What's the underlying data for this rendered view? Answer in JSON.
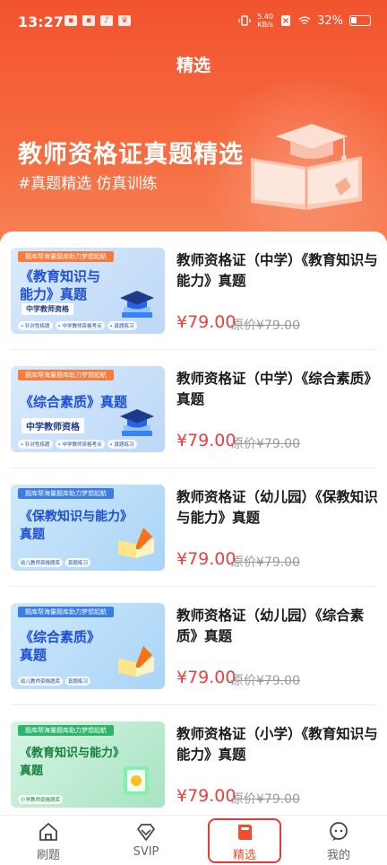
{
  "status_bar": {
    "time": "13:27",
    "net_speed_value": "5.40",
    "net_speed_unit": "KB/s",
    "battery": "32%"
  },
  "page": {
    "title": "精选"
  },
  "banner": {
    "title": "教师资格证真题精选",
    "subtitle": "#真题精选 仿真训练"
  },
  "items": [
    {
      "title": "教师资格证（中学）《教育知识与能力》真题",
      "price": "¥79.00",
      "original_price": "原价¥79.00",
      "thumb": {
        "tag": "题库帮海量题库助力梦想起航",
        "line1": "《教育知识与",
        "line2": "能力》真题",
        "sub": "中学教师资格",
        "chips": [
          "• 针对性练题",
          "• 中学教师资格考点",
          "• 真题练习"
        ]
      }
    },
    {
      "title": "教师资格证（中学）《综合素质》真题",
      "price": "¥79.00",
      "original_price": "原价¥79.00",
      "thumb": {
        "tag": "题库帮海量题库助力梦想起航",
        "line1": "《综合素质》真题",
        "line2": "",
        "sub": "中学教师资格",
        "chips": [
          "• 针对性练题",
          "• 中学教师资格考点",
          "• 真题练习"
        ]
      }
    },
    {
      "title": "教师资格证（幼儿园）《保教知识与能力》真题",
      "price": "¥79.00",
      "original_price": "原价¥79.00",
      "thumb": {
        "tag": "题库帮海量题库助力梦想起航",
        "line1": "《保教知识与能力》",
        "line2": "真题",
        "sub": "",
        "chips": [
          "幼儿教师资格题库",
          "真题练习"
        ]
      }
    },
    {
      "title": "教师资格证（幼儿园）《综合素质》真题",
      "price": "¥79.00",
      "original_price": "原价¥79.00",
      "thumb": {
        "tag": "题库帮海量题库助力梦想起航",
        "line1": "《综合素质》",
        "line2": "真题",
        "sub": "",
        "chips": [
          "幼儿教师资格题库",
          "真题练习"
        ]
      }
    },
    {
      "title": "教师资格证（小学）《教育知识与能力》真题",
      "price": "¥79.00",
      "original_price": "原价¥79.00",
      "thumb": {
        "tag": "题库帮海量题库助力梦想起航",
        "line1": "《教育知识与能力》",
        "line2": "真题",
        "sub": "",
        "chips": [
          "小学教师资格题库"
        ]
      }
    }
  ],
  "tabs": [
    {
      "label": "刷题",
      "icon": "home-icon"
    },
    {
      "label": "SVIP",
      "icon": "diamond-icon"
    },
    {
      "label": "精选",
      "icon": "book-icon",
      "active": true
    },
    {
      "label": "我的",
      "icon": "chat-icon"
    }
  ],
  "colors": {
    "accent": "#f04e2f",
    "price": "#ef3d3d",
    "highlight_box": "#e23b3b"
  }
}
